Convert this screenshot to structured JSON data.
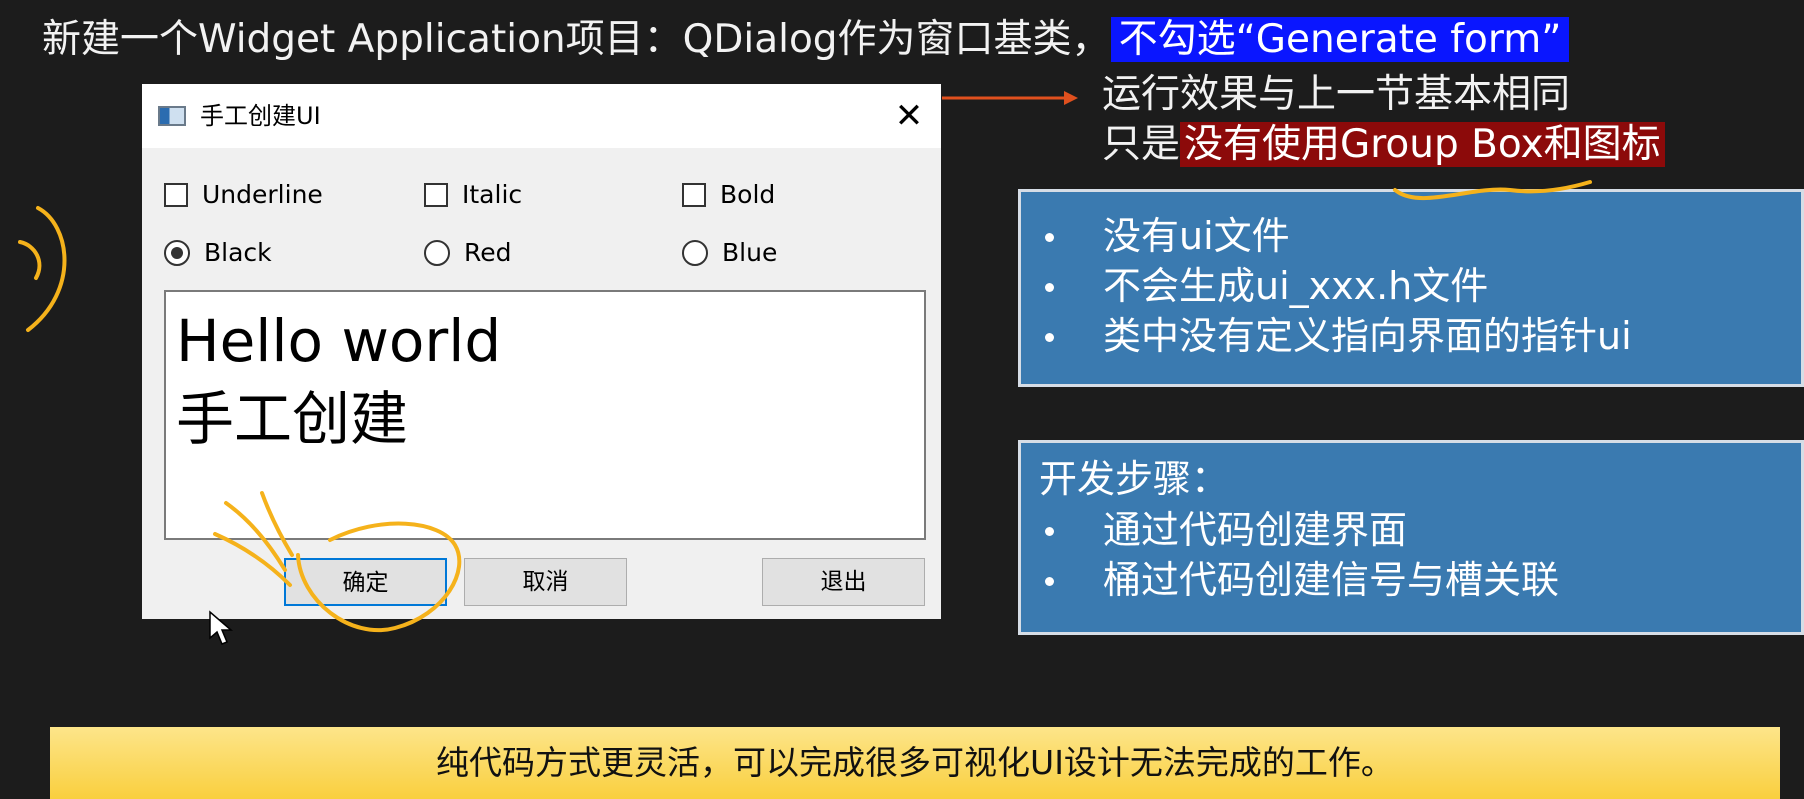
{
  "slide": {
    "title_prefix": "新建一个Widget Application项目：QDialog作为窗口基类，",
    "title_highlight": "不勾选“Generate form”",
    "note_line1": "运行效果与上一节基本相同",
    "note_line2_prefix": "只是",
    "note_line2_highlight": "没有使用Group Box和图标",
    "panel1": {
      "items": [
        "没有ui文件",
        "不会生成ui_xxx.h文件",
        "类中没有定义指向界面的指针ui"
      ]
    },
    "panel2": {
      "title": "开发步骤：",
      "items": [
        "通过代码创建界面",
        "桶过代码创建信号与槽关联"
      ]
    },
    "bottom_text": "纯代码方式更灵活，可以完成很多可视化UI设计无法完成的工作。"
  },
  "dialog": {
    "title": "手工创建UI",
    "close_icon": "close-icon",
    "app_icon": "window-app-icon",
    "checkboxes": [
      {
        "label": "Underline",
        "checked": false
      },
      {
        "label": "Italic",
        "checked": false
      },
      {
        "label": "Bold",
        "checked": false
      }
    ],
    "radios": [
      {
        "label": "Black",
        "selected": true
      },
      {
        "label": "Red",
        "selected": false
      },
      {
        "label": "Blue",
        "selected": false
      }
    ],
    "text_lines": [
      "Hello world",
      "手工创建"
    ],
    "buttons": {
      "ok": "确定",
      "cancel": "取消",
      "exit": "退出"
    }
  },
  "colors": {
    "title_highlight_bg": "#0a16ff",
    "note_highlight_bg": "#8c0a0a",
    "panel_bg": "#3a7ab0",
    "bottom_bar": "#f9cf3e",
    "annotation": "#f5b21b",
    "arrow": "#e0501e"
  }
}
